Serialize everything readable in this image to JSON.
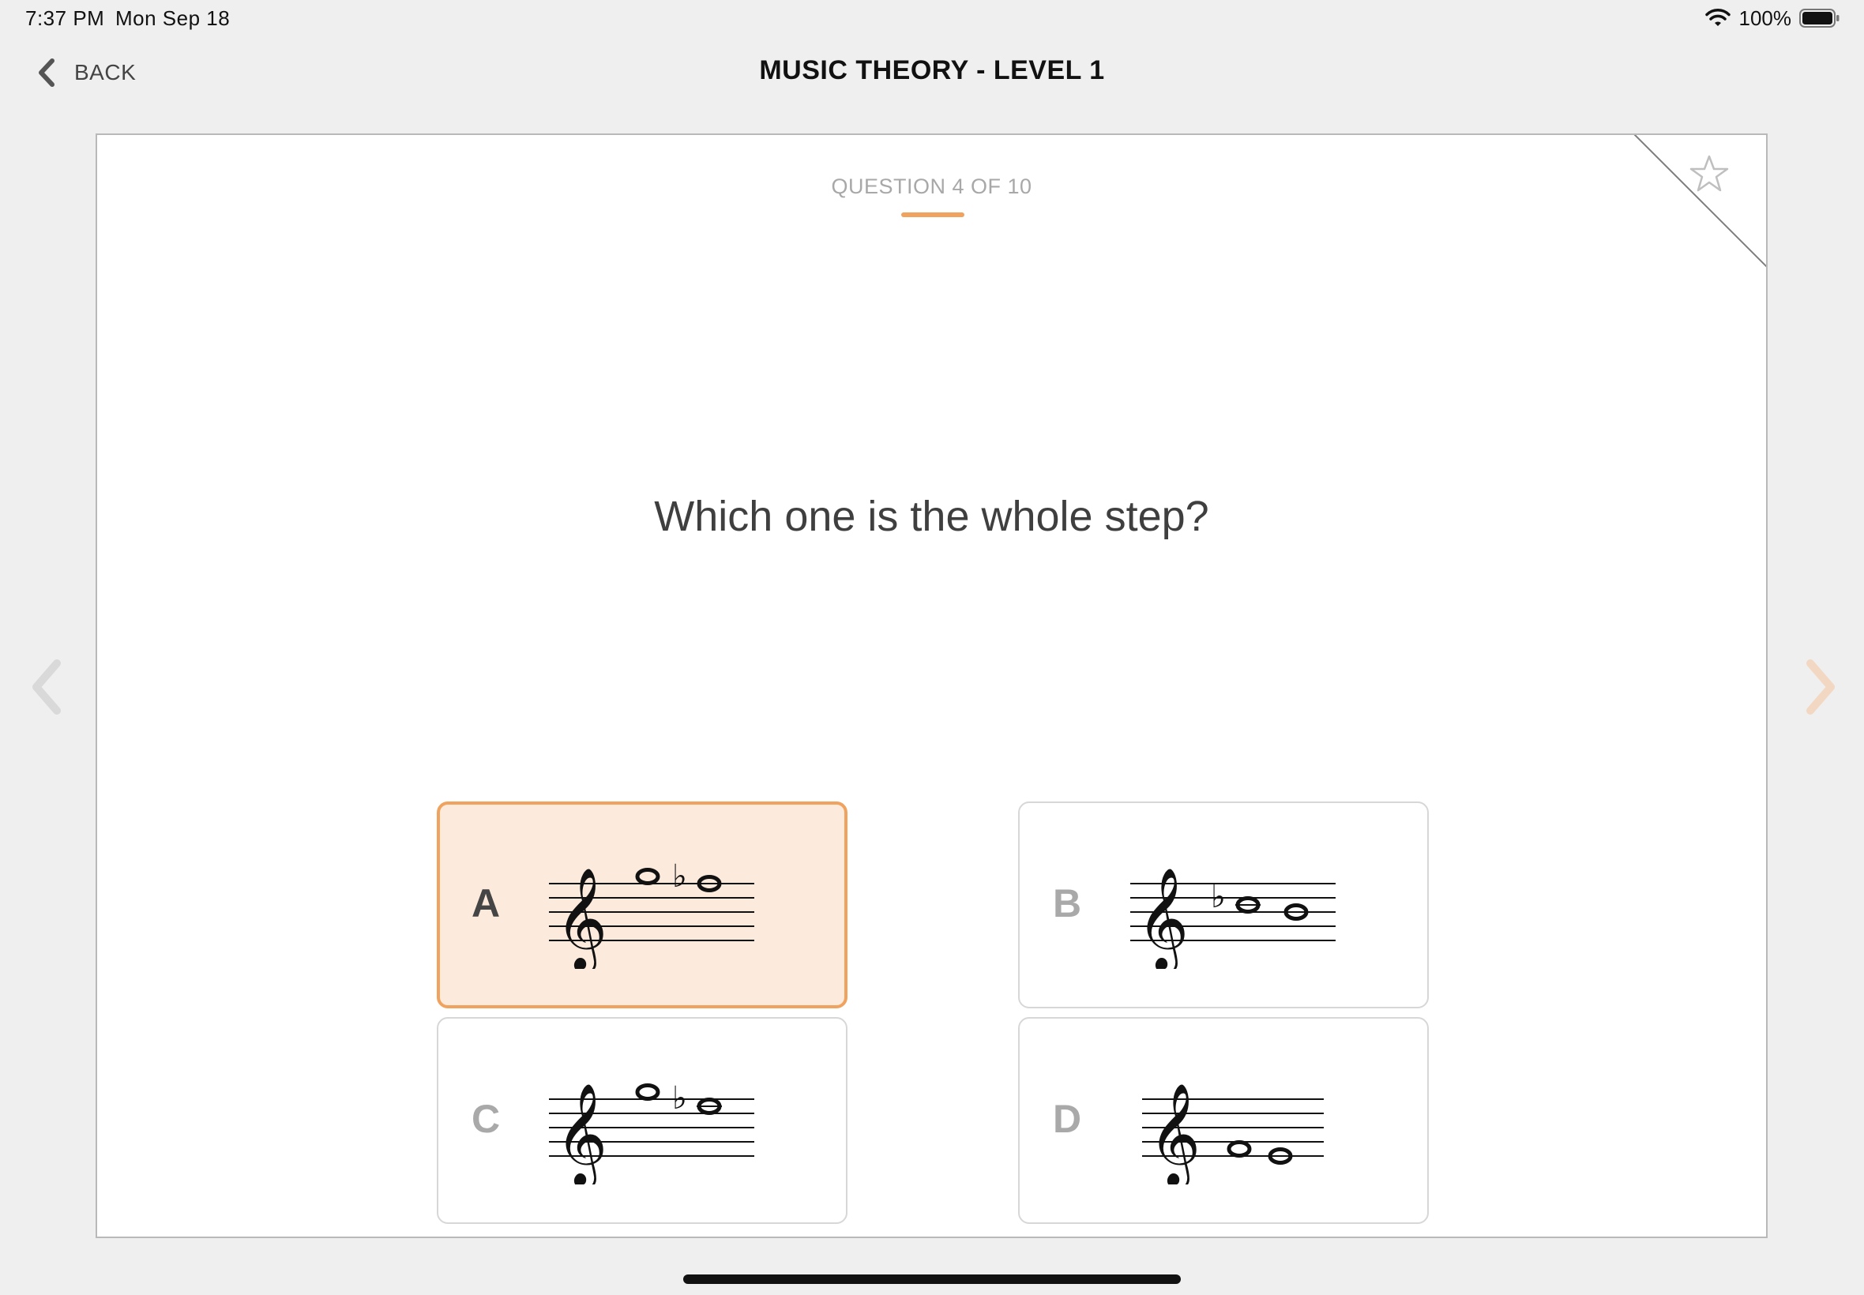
{
  "status_bar": {
    "time": "7:37 PM",
    "date": "Mon Sep 18",
    "battery": "100%",
    "icons": [
      "wifi-icon",
      "battery-icon"
    ]
  },
  "header": {
    "back_label": "BACK",
    "title": "MUSIC THEORY - LEVEL 1"
  },
  "quiz": {
    "counter": "QUESTION 4 OF 10",
    "question": "Which one is the whole step?",
    "selected_option": "A",
    "options": [
      {
        "letter": "A",
        "description": "treble-clef-staff",
        "selected": true
      },
      {
        "letter": "B",
        "description": "treble-clef-staff",
        "selected": false
      },
      {
        "letter": "C",
        "description": "treble-clef-staff",
        "selected": false
      },
      {
        "letter": "D",
        "description": "treble-clef-staff",
        "selected": false
      }
    ],
    "progress": {
      "current": 4,
      "total": 10
    }
  },
  "colors": {
    "accent": "#f0a35e",
    "selected_bg": "#fcebdd",
    "page_bg": "#efefef",
    "card_border": "#b9b9b9",
    "muted_text": "#a8a8a8"
  }
}
